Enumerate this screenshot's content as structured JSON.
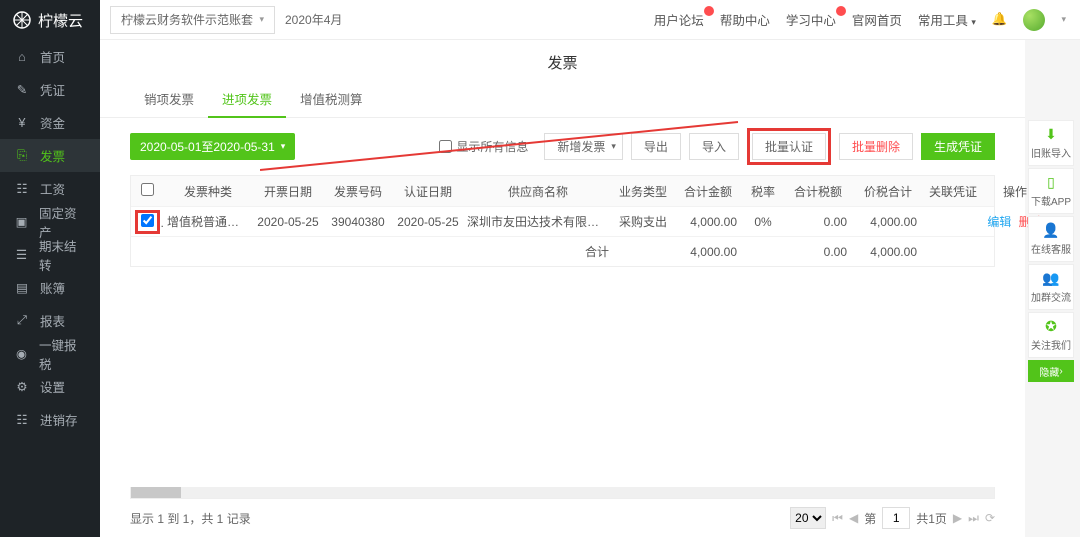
{
  "brand": "柠檬云",
  "topbar": {
    "account": "柠檬云财务软件示范账套",
    "period": "2020年4月",
    "links": {
      "forum": "用户论坛",
      "help": "帮助中心",
      "learn": "学习中心",
      "official": "官网首页",
      "tools": "常用工具"
    }
  },
  "sidebar": {
    "home": "首页",
    "voucher": "凭证",
    "funds": "资金",
    "invoice": "发票",
    "salary": "工资",
    "assets": "固定资产",
    "period": "期末结转",
    "books": "账簿",
    "reports": "报表",
    "tax": "一键报税",
    "settings": "设置",
    "stock": "进销存"
  },
  "page": {
    "title": "发票"
  },
  "tabs": {
    "sales": "销项发票",
    "purchase": "进项发票",
    "vat": "增值税测算"
  },
  "toolbar": {
    "date_range": "2020-05-01至2020-05-31",
    "show_all": "显示所有信息",
    "add": "新增发票",
    "export": "导出",
    "import": "导入",
    "batch_cert": "批量认证",
    "batch_del": "批量删除",
    "gen_voucher": "生成凭证"
  },
  "table": {
    "headers": {
      "type": "发票种类",
      "date": "开票日期",
      "no": "发票号码",
      "cert_date": "认证日期",
      "supplier": "供应商名称",
      "biz": "业务类型",
      "amount": "合计金额",
      "rate": "税率",
      "tax": "合计税额",
      "total": "价税合计",
      "voucher": "关联凭证",
      "ops": "操作"
    },
    "rows": [
      {
        "type": "增值税普通发票",
        "date": "2020-05-25",
        "no": "39040380",
        "cert_date": "2020-05-25",
        "supplier": "深圳市友田达技术有限公司",
        "biz": "采购支出",
        "amount": "4,000.00",
        "rate": "0%",
        "tax": "0.00",
        "total": "4,000.00",
        "voucher": ""
      }
    ],
    "sum": {
      "label": "合计",
      "amount": "4,000.00",
      "tax": "0.00",
      "total": "4,000.00"
    },
    "ops": {
      "edit": "编辑",
      "del": "删除"
    }
  },
  "footer": {
    "info": "显示 1 到 1，共 1 记录",
    "page_size": "20",
    "page_label_prefix": "第",
    "page_value": "1",
    "page_label_suffix": "共1页"
  },
  "dock": {
    "import": "旧账导入",
    "app": "下载APP",
    "service": "在线客服",
    "group": "加群交流",
    "follow": "关注我们",
    "hide": "隐藏"
  }
}
